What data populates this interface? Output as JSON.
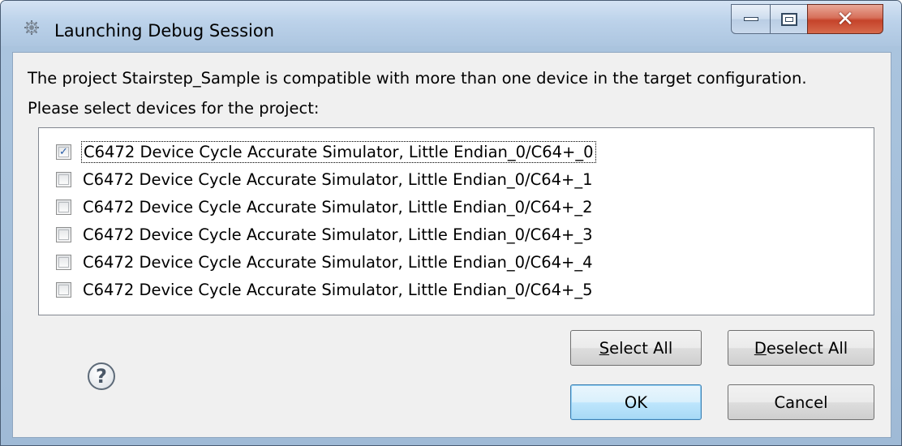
{
  "window": {
    "title": "Launching Debug Session",
    "controls": {
      "minimize_icon": "minimize-icon",
      "maximize_icon": "maximize-icon",
      "close_icon": "close-icon"
    }
  },
  "dialog": {
    "description_line1": "The project Stairstep_Sample is compatible with more than one device in the target configuration.",
    "description_line2": "Please select devices for the project:",
    "devices": [
      {
        "label": "C6472 Device Cycle Accurate Simulator, Little Endian_0/C64+_0",
        "checked": true
      },
      {
        "label": "C6472 Device Cycle Accurate Simulator, Little Endian_0/C64+_1",
        "checked": false
      },
      {
        "label": "C6472 Device Cycle Accurate Simulator, Little Endian_0/C64+_2",
        "checked": false
      },
      {
        "label": "C6472 Device Cycle Accurate Simulator, Little Endian_0/C64+_3",
        "checked": false
      },
      {
        "label": "C6472 Device Cycle Accurate Simulator, Little Endian_0/C64+_4",
        "checked": false
      },
      {
        "label": "C6472 Device Cycle Accurate Simulator, Little Endian_0/C64+_5",
        "checked": false
      }
    ]
  },
  "buttons": {
    "select_all_mnemonic": "S",
    "select_all_rest": "elect All",
    "deselect_all_mnemonic": "D",
    "deselect_all_rest": "eselect All",
    "ok": "OK",
    "cancel": "Cancel"
  },
  "help": {
    "glyph": "?"
  },
  "colors": {
    "title_bar": "#bcd2ea",
    "dialog_bg": "#f0f0f0",
    "close_button": "#c5432a",
    "default_button_border": "#3c7fb1"
  }
}
